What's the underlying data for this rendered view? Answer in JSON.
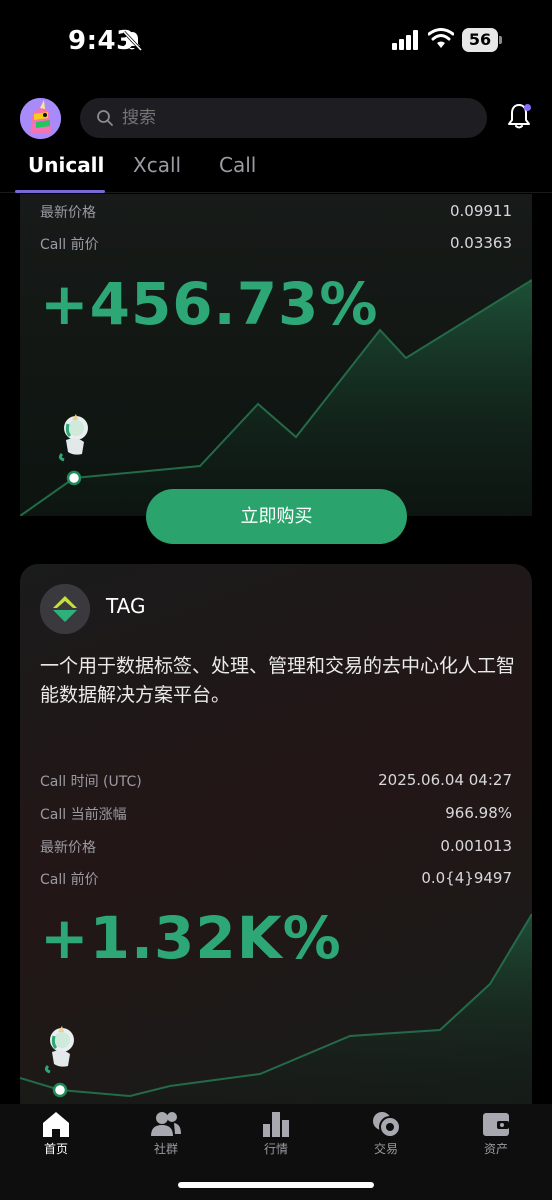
{
  "status": {
    "time": "9:43",
    "battery": "56"
  },
  "search": {
    "placeholder": "搜索"
  },
  "tabs": [
    {
      "label": "Unicall",
      "active": true
    },
    {
      "label": "Xcall",
      "active": false
    },
    {
      "label": "Call",
      "active": false
    }
  ],
  "card1": {
    "rows": [
      {
        "label": "最新价格",
        "value": "0.09911"
      },
      {
        "label": "Call 前价",
        "value": "0.03363"
      }
    ],
    "change": "+456.73%",
    "buy_label": "立即购买"
  },
  "card2": {
    "name": "TAG",
    "description": "一个用于数据标签、处理、管理和交易的去中心化人工智能数据解决方案平台。",
    "rows": [
      {
        "label": "Call 时间 (UTC)",
        "value": "2025.06.04 04:27"
      },
      {
        "label": "Call 当前涨幅",
        "value": "966.98%"
      },
      {
        "label": "最新价格",
        "value": "0.001013"
      },
      {
        "label": "Call 前价",
        "value": "0.0{4}9497"
      }
    ],
    "change": "+1.32K%"
  },
  "nav": [
    {
      "label": "首页",
      "icon": "home-icon",
      "active": true
    },
    {
      "label": "社群",
      "icon": "community-icon",
      "active": false
    },
    {
      "label": "行情",
      "icon": "market-icon",
      "active": false
    },
    {
      "label": "交易",
      "icon": "trade-icon",
      "active": false
    },
    {
      "label": "资产",
      "icon": "wallet-icon",
      "active": false
    }
  ],
  "colors": {
    "accent": "#7c66d8",
    "positive": "#2ea776",
    "button": "#2aa46c"
  }
}
